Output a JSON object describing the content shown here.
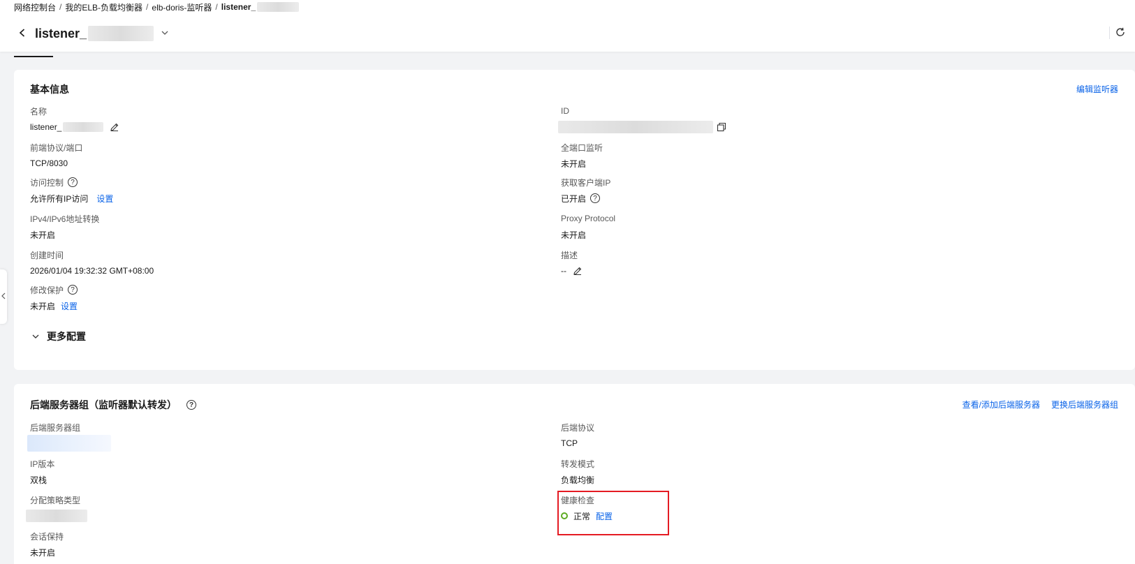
{
  "breadcrumb": [
    {
      "label": "网络控制台"
    },
    {
      "label": "我的ELB-负载均衡器"
    },
    {
      "label": "elb-doris-监听器"
    },
    {
      "label": "listener_"
    }
  ],
  "header": {
    "title": "listener_",
    "back_icon": "back-arrow-icon",
    "dropdown_icon": "chevron-down-icon",
    "refresh_icon": "refresh-icon"
  },
  "basic": {
    "title": "基本信息",
    "edit_link": "编辑监听器",
    "fields": {
      "name": {
        "label": "名称",
        "value": "listener_"
      },
      "id": {
        "label": "ID",
        "value": ""
      },
      "frontend": {
        "label": "前端协议/端口",
        "value": "TCP/8030"
      },
      "all_port": {
        "label": "全端口监听",
        "value": "未开启"
      },
      "access_control": {
        "label": "访问控制",
        "value": "允许所有IP访问",
        "action": "设置"
      },
      "client_ip": {
        "label": "获取客户端IP",
        "value": "已开启"
      },
      "ipv4_v6": {
        "label": "IPv4/IPv6地址转换",
        "value": "未开启"
      },
      "proxy_protocol": {
        "label": "Proxy Protocol",
        "value": "未开启"
      },
      "created": {
        "label": "创建时间",
        "value": "2026/01/04 19:32:32 GMT+08:00"
      },
      "description": {
        "label": "描述",
        "value": "--"
      },
      "modify_protect": {
        "label": "修改保护",
        "value": "未开启",
        "action": "设置"
      }
    },
    "more_config": "更多配置"
  },
  "backend": {
    "title": "后端服务器组（监听器默认转发）",
    "view_add_link": "查看/添加后端服务器",
    "change_link": "更换后端服务器组",
    "fields": {
      "group": {
        "label": "后端服务器组",
        "value": ""
      },
      "protocol": {
        "label": "后端协议",
        "value": "TCP"
      },
      "ip_version": {
        "label": "IP版本",
        "value": "双栈"
      },
      "forward_mode": {
        "label": "转发模式",
        "value": "负载均衡"
      },
      "policy_type": {
        "label": "分配策略类型",
        "value": ""
      },
      "health_check": {
        "label": "健康检查",
        "value": "正常",
        "action": "配置"
      },
      "session": {
        "label": "会话保持",
        "value": "未开启"
      }
    }
  },
  "colors": {
    "link": "#0a63e8",
    "status_ok": "#5dab22",
    "highlight": "#e41b23"
  }
}
